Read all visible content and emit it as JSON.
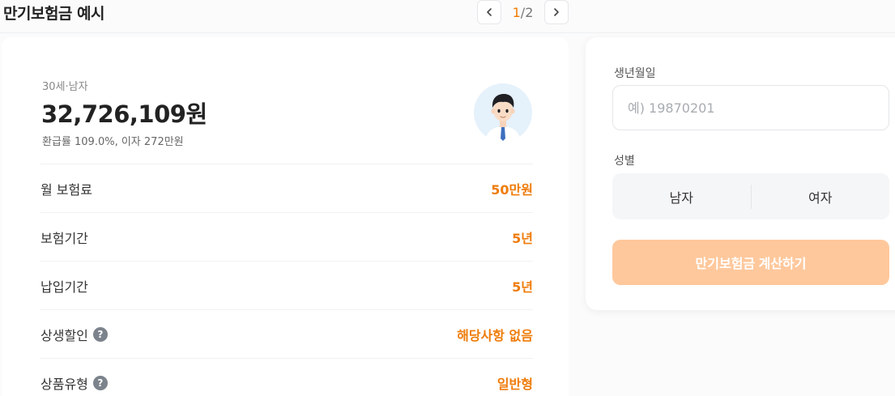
{
  "header": {
    "title": "만기보험금 예시",
    "pager": {
      "current": "1",
      "separator": "/",
      "total": "2"
    }
  },
  "profile": {
    "subtitle": "30세·남자",
    "amount": "32,726,109원",
    "detail": "환급률 109.0%, 이자 272만원"
  },
  "rows": [
    {
      "label": "월 보험료",
      "value": "50만원",
      "help": false
    },
    {
      "label": "보험기간",
      "value": "5년",
      "help": false
    },
    {
      "label": "납입기간",
      "value": "5년",
      "help": false
    },
    {
      "label": "상생할인",
      "value": "해당사항 없음",
      "help": true
    },
    {
      "label": "상품유형",
      "value": "일반형",
      "help": true
    }
  ],
  "help_icon_glyph": "?",
  "form": {
    "birth_label": "생년월일",
    "birth_placeholder": "예) 19870201",
    "birth_value": "",
    "gender_label": "성별",
    "gender_options": [
      "남자",
      "여자"
    ],
    "submit_label": "만기보험금 계산하기"
  },
  "colors": {
    "accent": "#ef7c0a",
    "button_disabled": "#ffc89c",
    "avatar_bg": "#e5f1fb"
  }
}
